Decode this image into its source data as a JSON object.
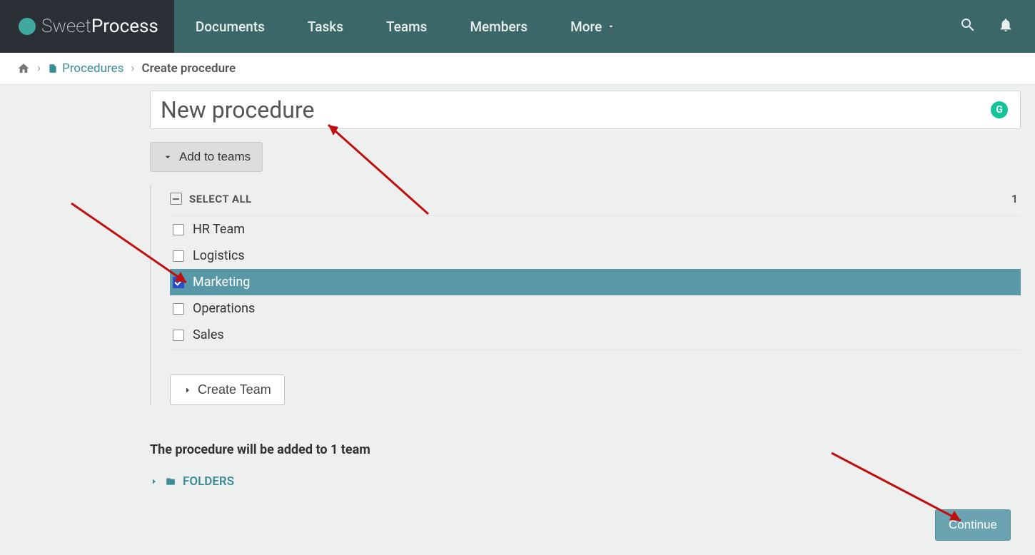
{
  "brand": {
    "thin": "Sweet",
    "bold": "Process"
  },
  "nav": {
    "documents": "Documents",
    "tasks": "Tasks",
    "teams": "Teams",
    "members": "Members",
    "more": "More"
  },
  "breadcrumb": {
    "procedures": "Procedures",
    "current": "Create procedure"
  },
  "form": {
    "title_placeholder": "New procedure",
    "title_value": "New procedure",
    "add_to_teams": "Add to teams",
    "select_all": "SELECT ALL",
    "selected_count": "1",
    "teams": [
      {
        "label": "HR Team",
        "checked": false
      },
      {
        "label": "Logistics",
        "checked": false
      },
      {
        "label": "Marketing",
        "checked": true
      },
      {
        "label": "Operations",
        "checked": false
      },
      {
        "label": "Sales",
        "checked": false
      }
    ],
    "create_team": "Create Team",
    "summary": "The procedure will be added to 1 team",
    "folders": "FOLDERS",
    "continue": "Continue"
  }
}
